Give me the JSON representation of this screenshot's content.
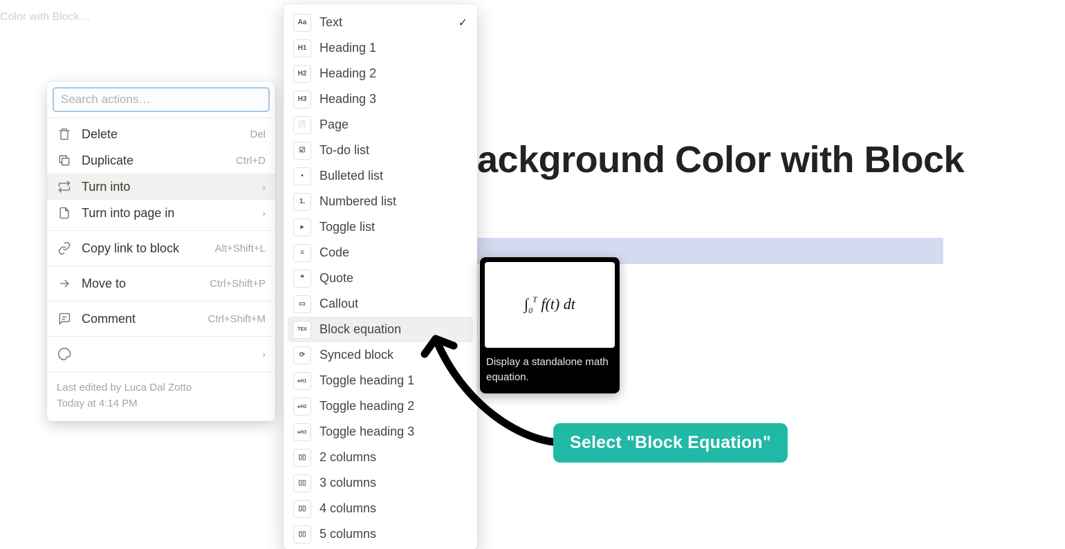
{
  "breadcrumb_hint": "Color with Block…",
  "page_title_fragment": "ackground Color with Block",
  "context_menu": {
    "search_placeholder": "Search actions…",
    "items": [
      {
        "icon": "trash",
        "label": "Delete",
        "shortcut": "Del"
      },
      {
        "icon": "duplicate",
        "label": "Duplicate",
        "shortcut": "Ctrl+D"
      },
      {
        "icon": "turninto",
        "label": "Turn into",
        "chevron": true,
        "hover": true
      },
      {
        "icon": "page",
        "label": "Turn into page in",
        "chevron": true
      }
    ],
    "items2": [
      {
        "icon": "link",
        "label": "Copy link to block",
        "shortcut": "Alt+Shift+L"
      }
    ],
    "items3": [
      {
        "icon": "moveto",
        "label": "Move to",
        "shortcut": "Ctrl+Shift+P"
      }
    ],
    "items4": [
      {
        "icon": "comment",
        "label": "Comment",
        "shortcut": "Ctrl+Shift+M"
      }
    ],
    "items5": [
      {
        "icon": "color",
        "label": "",
        "chevron": true
      }
    ],
    "footer_line1": "Last edited by Luca Dal Zotto",
    "footer_line2": "Today at 4:14 PM"
  },
  "submenu": {
    "items": [
      {
        "thumb": "Aa",
        "label": "Text",
        "checked": true
      },
      {
        "thumb": "H1",
        "label": "Heading 1"
      },
      {
        "thumb": "H2",
        "label": "Heading 2"
      },
      {
        "thumb": "H3",
        "label": "Heading 3"
      },
      {
        "thumb": "📄",
        "label": "Page"
      },
      {
        "thumb": "☑",
        "label": "To-do list"
      },
      {
        "thumb": "•",
        "label": "Bulleted list"
      },
      {
        "thumb": "1.",
        "label": "Numbered list"
      },
      {
        "thumb": "▸",
        "label": "Toggle list"
      },
      {
        "thumb": "≡",
        "label": "Code"
      },
      {
        "thumb": "❝",
        "label": "Quote"
      },
      {
        "thumb": "▭",
        "label": "Callout"
      },
      {
        "thumb": "TEX",
        "label": "Block equation",
        "hover": true
      },
      {
        "thumb": "⟳",
        "label": "Synced block"
      },
      {
        "thumb": "▸H1",
        "label": "Toggle heading 1"
      },
      {
        "thumb": "▸H2",
        "label": "Toggle heading 2"
      },
      {
        "thumb": "▸H3",
        "label": "Toggle heading 3"
      },
      {
        "thumb": "▯▯",
        "label": "2 columns"
      },
      {
        "thumb": "▯▯",
        "label": "3 columns"
      },
      {
        "thumb": "▯▯",
        "label": "4 columns"
      },
      {
        "thumb": "▯▯",
        "label": "5 columns"
      }
    ]
  },
  "preview": {
    "equation": "∫₀ᵀ f(t) dt",
    "description": "Display a standalone math equation."
  },
  "annotation": {
    "label": "Select \"Block Equation\""
  }
}
